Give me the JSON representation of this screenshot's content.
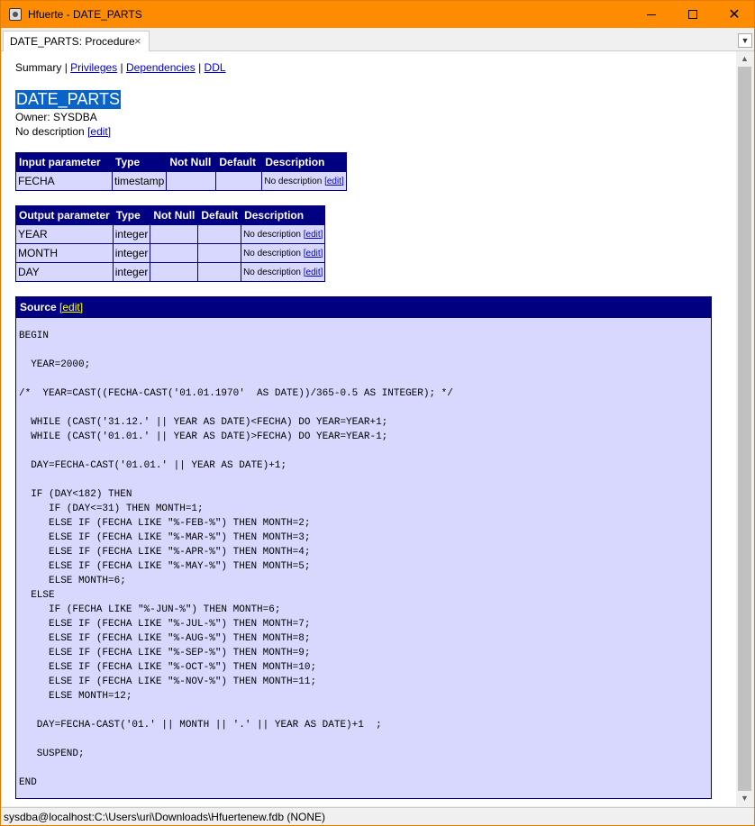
{
  "window": {
    "title": "Hfuerte - DATE_PARTS"
  },
  "tab": {
    "label": "DATE_PARTS: Procedure",
    "close": "×"
  },
  "nav": {
    "summary": "Summary",
    "sep": "|",
    "privileges": "Privileges",
    "dependencies": "Dependencies",
    "ddl": "DDL"
  },
  "header": {
    "title": "DATE_PARTS",
    "owner": "Owner: SYSDBA",
    "description": "No description",
    "edit": "[edit]"
  },
  "input_params": {
    "headers": [
      "Input parameter",
      "Type",
      "Not Null",
      "Default",
      "Description"
    ],
    "rows": [
      {
        "name": "FECHA",
        "type": "timestamp",
        "not_null": "",
        "default": "",
        "description": "No description",
        "edit": "[edit]"
      }
    ]
  },
  "output_params": {
    "headers": [
      "Output parameter",
      "Type",
      "Not Null",
      "Default",
      "Description"
    ],
    "rows": [
      {
        "name": "YEAR",
        "type": "integer",
        "not_null": "",
        "default": "",
        "description": "No description",
        "edit": "[edit]"
      },
      {
        "name": "MONTH",
        "type": "integer",
        "not_null": "",
        "default": "",
        "description": "No description",
        "edit": "[edit]"
      },
      {
        "name": "DAY",
        "type": "integer",
        "not_null": "",
        "default": "",
        "description": "No description",
        "edit": "[edit]"
      }
    ]
  },
  "source": {
    "label": "Source",
    "edit": "[edit]",
    "code": "BEGIN\n\n  YEAR=2000;\n\n/*  YEAR=CAST((FECHA-CAST('01.01.1970'  AS DATE))/365-0.5 AS INTEGER); */\n\n  WHILE (CAST('31.12.' || YEAR AS DATE)<FECHA) DO YEAR=YEAR+1;\n  WHILE (CAST('01.01.' || YEAR AS DATE)>FECHA) DO YEAR=YEAR-1;\n\n  DAY=FECHA-CAST('01.01.' || YEAR AS DATE)+1;\n\n  IF (DAY<182) THEN\n     IF (DAY<=31) THEN MONTH=1;\n     ELSE IF (FECHA LIKE \"%-FEB-%\") THEN MONTH=2;\n     ELSE IF (FECHA LIKE \"%-MAR-%\") THEN MONTH=3;\n     ELSE IF (FECHA LIKE \"%-APR-%\") THEN MONTH=4;\n     ELSE IF (FECHA LIKE \"%-MAY-%\") THEN MONTH=5;\n     ELSE MONTH=6;\n  ELSE\n     IF (FECHA LIKE \"%-JUN-%\") THEN MONTH=6;\n     ELSE IF (FECHA LIKE \"%-JUL-%\") THEN MONTH=7;\n     ELSE IF (FECHA LIKE \"%-AUG-%\") THEN MONTH=8;\n     ELSE IF (FECHA LIKE \"%-SEP-%\") THEN MONTH=9;\n     ELSE IF (FECHA LIKE \"%-OCT-%\") THEN MONTH=10;\n     ELSE IF (FECHA LIKE \"%-NOV-%\") THEN MONTH=11;\n     ELSE MONTH=12;\n\n   DAY=FECHA-CAST('01.' || MONTH || '.' || YEAR AS DATE)+1  ;\n\n   SUSPEND;\n\nEND"
  },
  "status": {
    "text": "sysdba@localhost:C:\\Users\\uri\\Downloads\\Hfuertenew.fdb (NONE)"
  },
  "colors": {
    "titlebar": "#ff8c00",
    "table_header": "#000080",
    "table_body": "#d8d8ff",
    "selection": "#0a64c8"
  }
}
